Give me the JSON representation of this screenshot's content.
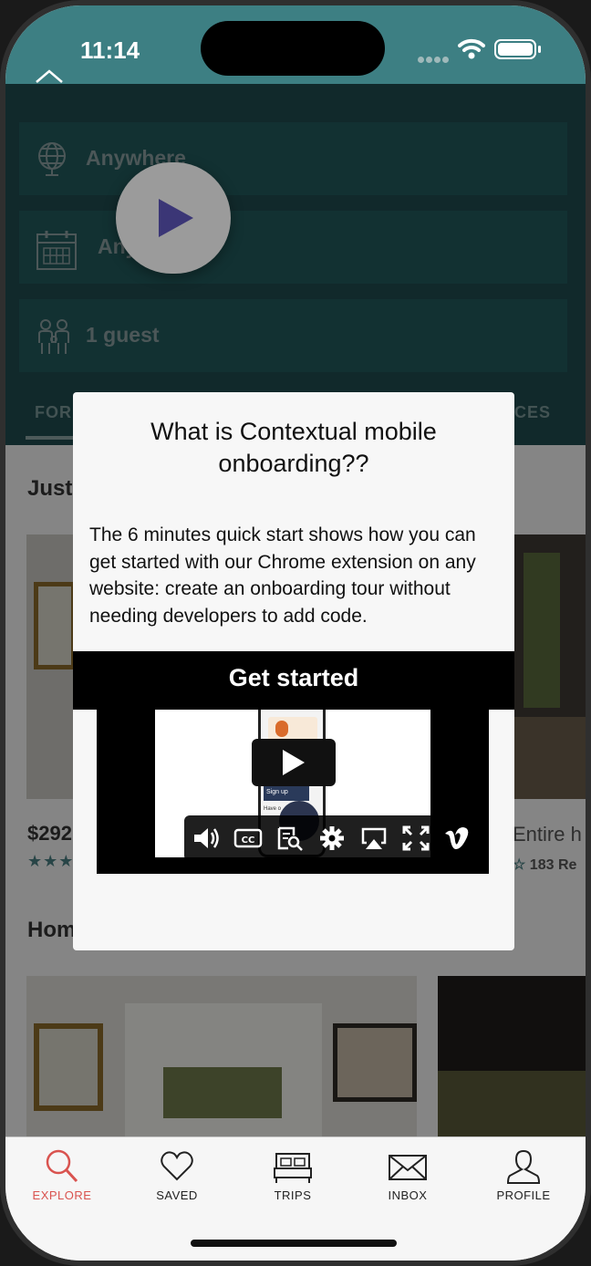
{
  "status_bar": {
    "time": "11:14"
  },
  "search": {
    "location": "Anywhere",
    "dates": "Any",
    "guests": "1 guest"
  },
  "tabs": {
    "left_partial": "FOR",
    "right_partial": "CES"
  },
  "content": {
    "section1_title": "Just",
    "price_left": "$292",
    "caption_right": "Entire h",
    "reviews_right": "183 Re",
    "section2_title": "Hom"
  },
  "modal": {
    "title": "What is Contextual mobile onboarding??",
    "body": "The 6 minutes quick start shows how you can get started with our Chrome extension on any website: create an onboarding tour without needing developers to add code.",
    "video_title": "Get started",
    "video_mini_labels": [
      "Sign up",
      "Have o"
    ]
  },
  "video_controls": [
    "volume-icon",
    "closed-captions-icon",
    "transcript-icon",
    "settings-icon",
    "airplay-icon",
    "fullscreen-icon",
    "vimeo-logo"
  ],
  "tabbar": {
    "items": [
      {
        "label": "EXPLORE",
        "icon": "search-icon",
        "active": true
      },
      {
        "label": "SAVED",
        "icon": "heart-icon",
        "active": false
      },
      {
        "label": "TRIPS",
        "icon": "bed-icon",
        "active": false
      },
      {
        "label": "INBOX",
        "icon": "envelope-icon",
        "active": false
      },
      {
        "label": "PROFILE",
        "icon": "person-icon",
        "active": false
      }
    ]
  },
  "colors": {
    "header_teal": "#3d7f83",
    "accent_red": "#d9534f",
    "play_purple": "#3b3676"
  }
}
